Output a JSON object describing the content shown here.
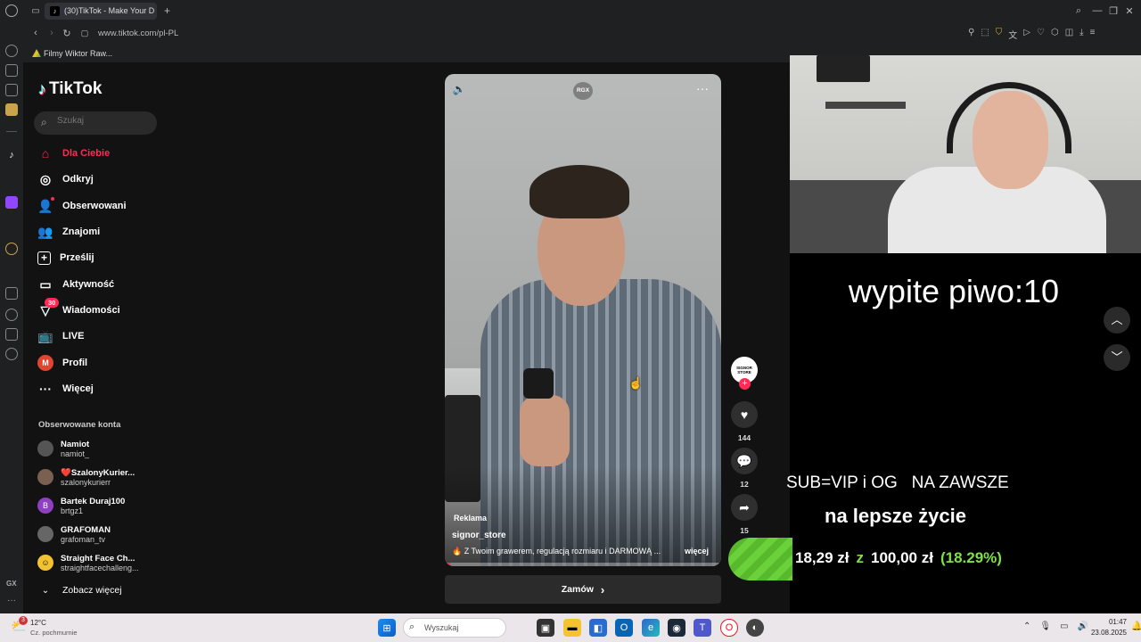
{
  "browser": {
    "tab_title": "(30)TikTok - Make Your D",
    "url": "www.tiktok.com/pl-PL",
    "bookmark": "Filmy Wiktor Raw..."
  },
  "tiktok": {
    "logo": "TikTok",
    "search_placeholder": "Szukaj",
    "nav": [
      {
        "label": "Dla Ciebie",
        "icon": "home-icon"
      },
      {
        "label": "Odkryj",
        "icon": "compass-icon"
      },
      {
        "label": "Obserwowani",
        "icon": "following-icon"
      },
      {
        "label": "Znajomi",
        "icon": "friends-icon"
      },
      {
        "label": "Prześlij",
        "icon": "upload-icon"
      },
      {
        "label": "Aktywność",
        "icon": "activity-icon"
      },
      {
        "label": "Wiadomości",
        "icon": "messages-icon",
        "badge": "30"
      },
      {
        "label": "LIVE",
        "icon": "live-icon"
      },
      {
        "label": "Profil",
        "icon": "profile-icon",
        "avatar_letter": "M"
      },
      {
        "label": "Więcej",
        "icon": "more-icon"
      }
    ],
    "following_header": "Obserwowane konta",
    "accounts": [
      {
        "name": "Namiot",
        "handle": "namiot_"
      },
      {
        "name": "❤️SzalonyKurier...",
        "handle": "szalonykurierr"
      },
      {
        "name": "Bartek Duraj100",
        "handle": "brtgz1",
        "letter": "B"
      },
      {
        "name": "GRAFOMAN",
        "handle": "grafoman_tv"
      },
      {
        "name": "Straight Face Ch...",
        "handle": "straightfacechalleng..."
      }
    ],
    "see_more": "Zobacz więcej",
    "video": {
      "top_badge": "RGX",
      "ad_label": "Reklama",
      "author": "signor_store",
      "caption": "🔥 Z Twoim grawerem, regulacją rozmiaru i DARMOWĄ ...",
      "more": "więcej",
      "progress": 0.02
    },
    "actions": {
      "avatar_text": "SIGNOR STORE",
      "likes": "144",
      "comments": "12",
      "shares": "15"
    },
    "order_button": "Zamów"
  },
  "stream_overlay": {
    "counter": "wypite piwo:10",
    "sub_text": "SUB=VIP i OG   NA ZAWSZE",
    "goal_title": "na lepsze życie",
    "goal_current": "18,29 zł",
    "goal_sep": "z",
    "goal_target": "100,00 zł",
    "goal_percent": "(18.29%)",
    "goal_fraction": 0.1829
  },
  "taskbar": {
    "weather_temp": "12°C",
    "weather_desc": "Cz. pochmurnie",
    "weather_badge": "3",
    "search_placeholder": "Wyszukaj",
    "time": "01:47",
    "date": "23.08.2025"
  },
  "colors": {
    "accent": "#fe2c55",
    "green": "#6bd13b",
    "goal_pct": "#7ee04a"
  }
}
